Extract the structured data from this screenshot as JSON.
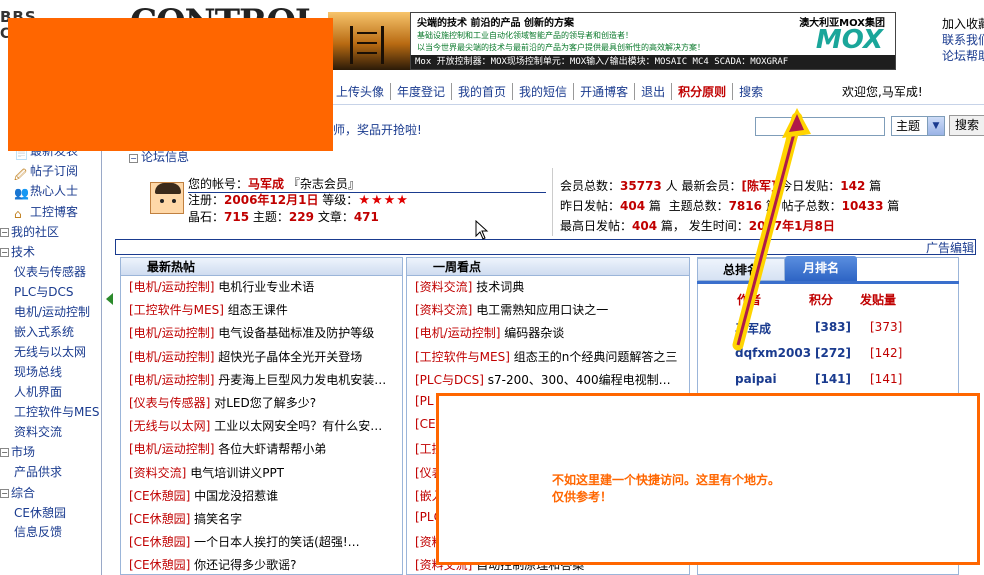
{
  "header": {
    "logo_left": [
      "BBS",
      "C"
    ],
    "logo_control": "CONTROL",
    "ad": {
      "slogan": "尖端的技术  前沿的产品  创新的方案",
      "company": "澳大利亚MOX集团",
      "line2": "基础设施控制和工业自动化领域智能产品的领导者和创造者！",
      "line3": "以当今世界最尖端的技术与最前沿的产品为客户提供最具创新性的高效解决方案！",
      "brand": "MOX",
      "bar": "Mox 开放控制器：MOX现场控制单元：MOX输入/输出模块：MOSAIC MC4 SCADA：MOXGRAF"
    },
    "right_links": [
      "加入收藏",
      "联系我们",
      "论坛帮助"
    ]
  },
  "nav": {
    "items": [
      "上传头像",
      "年度登记",
      "我的首页",
      "我的短信",
      "开通博客",
      "退出",
      "积分原则",
      "搜索"
    ],
    "bold_index": 6,
    "welcome": "欢迎您,马军成!"
  },
  "marquee": "师，奖品开抢啦!",
  "search": {
    "select_value": "主题",
    "button": "搜索"
  },
  "sidebar": {
    "items": [
      {
        "label": "最新发表",
        "type": "icon-item",
        "icon": "document-icon"
      },
      {
        "label": "帖子订阅",
        "type": "icon-item",
        "icon": "subscribe-icon"
      },
      {
        "label": "热心人士",
        "type": "icon-item",
        "icon": "people-icon"
      },
      {
        "label": "工控博客",
        "type": "icon-item",
        "icon": "home-icon"
      },
      {
        "label": "我的社区",
        "type": "cat"
      },
      {
        "label": "技术",
        "type": "cat"
      },
      {
        "label": "仪表与传感器",
        "type": "sub"
      },
      {
        "label": "PLC与DCS",
        "type": "sub"
      },
      {
        "label": "电机/运动控制",
        "type": "sub"
      },
      {
        "label": "嵌入式系统",
        "type": "sub"
      },
      {
        "label": "无线与以太网",
        "type": "sub"
      },
      {
        "label": "现场总线",
        "type": "sub"
      },
      {
        "label": "人机界面",
        "type": "sub"
      },
      {
        "label": "工控软件与MES",
        "type": "sub"
      },
      {
        "label": "资料交流",
        "type": "sub"
      },
      {
        "label": "市场",
        "type": "cat"
      },
      {
        "label": "产品供求",
        "type": "sub"
      },
      {
        "label": "综合",
        "type": "cat"
      },
      {
        "label": "CE休憩园",
        "type": "sub"
      },
      {
        "label": "信息反馈",
        "type": "sub"
      }
    ]
  },
  "forum_info": {
    "heading": "论坛信息",
    "account": {
      "label": "您的帐号：",
      "name": "马军成",
      "group": "『杂志会员』",
      "reg_label": "注册：",
      "reg_date": "2006年12月1日",
      "level_label": "等级：",
      "stars": "★★★★",
      "stone_label": "晶石：",
      "stone": "715",
      "topic_label": "主题：",
      "topics": "229",
      "article_label": "文章：",
      "articles": "471"
    },
    "stats": {
      "members_label": "会员总数：",
      "members": "35773",
      "members_unit": "人",
      "newest_label": "最新会员：",
      "newest": "[陈军]",
      "today_label": "今日发贴：",
      "today": "142",
      "unit": "篇",
      "yesterday_label": "昨日发帖：",
      "yesterday": "404",
      "topics_label": "主题总数：",
      "topics": "7816",
      "posts_label": "帖子总数：",
      "posts": "10433",
      "max_label": "最高日发帖：",
      "max": "404",
      "time_label": "，  发生时间：",
      "time": "2007年1月8日"
    }
  },
  "ad_edit": "广告编辑",
  "hot": {
    "title": "最新热帖",
    "posts": [
      {
        "tag": "[电机/运动控制]",
        "title": "电机行业专业术语"
      },
      {
        "tag": "[工控软件与MES]",
        "title": "组态王课件"
      },
      {
        "tag": "[电机/运动控制]",
        "title": "电气设备基础标准及防护等级"
      },
      {
        "tag": "[电机/运动控制]",
        "title": "超快光子晶体全光开关登场"
      },
      {
        "tag": "[电机/运动控制]",
        "title": "丹麦海上巨型风力发电机安装…"
      },
      {
        "tag": "[仪表与传感器]",
        "title": "对LED您了解多少?"
      },
      {
        "tag": "[无线与以太网]",
        "title": "工业以太网安全吗？有什么安…"
      },
      {
        "tag": "[电机/运动控制]",
        "title": "各位大虾请帮帮小弟"
      },
      {
        "tag": "[资料交流]",
        "title": "电气培训讲义PPT"
      },
      {
        "tag": "[CE休憩园]",
        "title": "中国龙没招惹谁"
      },
      {
        "tag": "[CE休憩园]",
        "title": "搞笑名字"
      },
      {
        "tag": "[CE休憩园]",
        "title": "一个日本人挨打的笑话(超强!…"
      },
      {
        "tag": "[CE休憩园]",
        "title": "你还记得多少歌谣?"
      }
    ]
  },
  "week": {
    "title": "一周看点",
    "posts": [
      {
        "tag": "[资料交流]",
        "title": "技术词典"
      },
      {
        "tag": "[资料交流]",
        "title": "电工需熟知应用口诀之一"
      },
      {
        "tag": "[电机/运动控制]",
        "title": "编码器杂谈"
      },
      {
        "tag": "[工控软件与MES]",
        "title": "组态王的n个经典问题解答之三"
      },
      {
        "tag": "[PLC与DCS]",
        "title": "s7-200、300、400编程电视制…"
      },
      {
        "tag": "[PL",
        "title": ""
      },
      {
        "tag": "[CE",
        "title": ""
      },
      {
        "tag": "[工控",
        "title": ""
      },
      {
        "tag": "[仪表",
        "title": ""
      },
      {
        "tag": "[嵌入",
        "title": ""
      },
      {
        "tag": "[PLC",
        "title": ""
      },
      {
        "tag": "[资料",
        "title": ""
      },
      {
        "tag": "[资料交流]",
        "title": "自动控制原理和答案"
      }
    ]
  },
  "rank": {
    "tab1": "总排名",
    "tab2": "月排名",
    "col_author": "作者",
    "col_score": "积分",
    "col_posts": "发贴量",
    "rows": [
      {
        "name": "马军成",
        "score": "[383]",
        "posts": "[373]"
      },
      {
        "name": "dqfxm2003",
        "score": "[272]",
        "posts": "[142]"
      },
      {
        "name": "paipai",
        "score": "[141]",
        "posts": "[141]"
      }
    ]
  },
  "popup": {
    "line1": "不如这里建一个快捷访问。这里有个地方。",
    "line2": "仅供参考！"
  },
  "colors": {
    "annotation_orange": "#ff6600",
    "link_blue": "#1a3b8f",
    "tag_red": "#c00000",
    "arrow_yellow": "#ffd400",
    "arrow_dark": "#6a1a6a"
  }
}
